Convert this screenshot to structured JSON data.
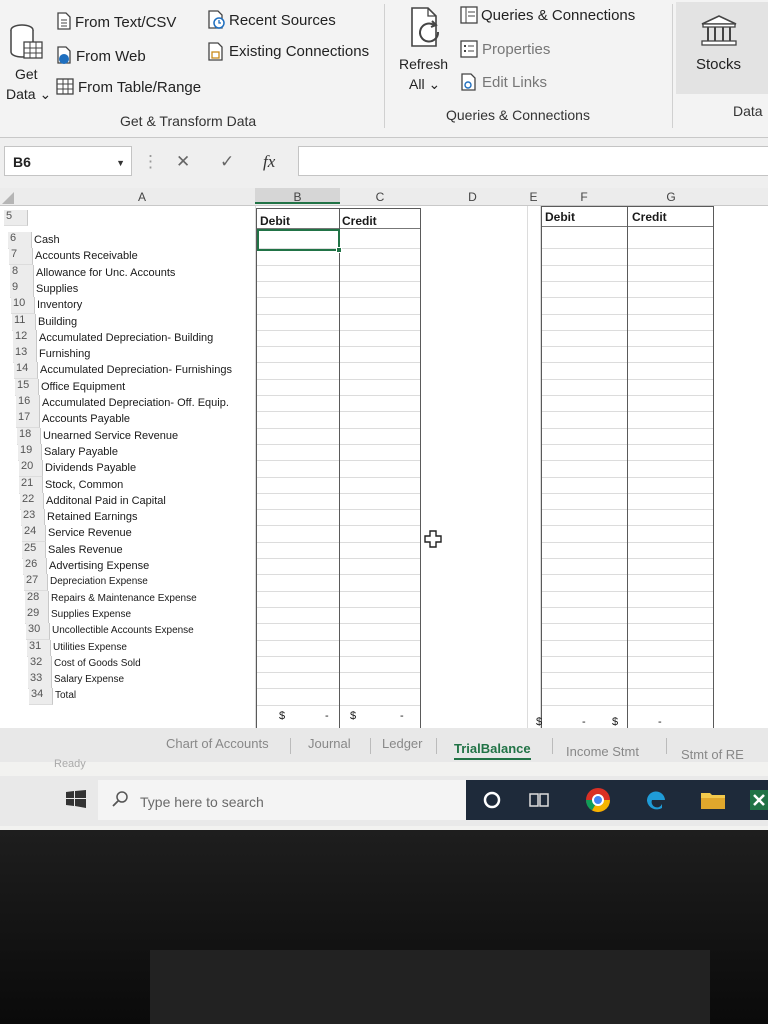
{
  "ribbon": {
    "get_data": {
      "line1": "Get",
      "line2": "Data ⌄"
    },
    "from_text_csv": "From Text/CSV",
    "from_web": "From Web",
    "from_table_range": "From Table/Range",
    "recent_sources": "Recent Sources",
    "existing_connections": "Existing Connections",
    "group_get_transform": "Get & Transform Data",
    "refresh_all": {
      "line1": "Refresh",
      "line2": "All ⌄"
    },
    "queries_connections": "Queries & Connections",
    "properties": "Properties",
    "edit_links": "Edit Links",
    "group_queries": "Queries & Connections",
    "stocks": "Stocks",
    "group_data": "Data"
  },
  "formula_bar": {
    "name_box": "B6",
    "fx": "fx",
    "cancel": "✕",
    "enter": "✓",
    "dots": "⋮"
  },
  "grid": {
    "columns": [
      "A",
      "B",
      "C",
      "D",
      "E",
      "F",
      "G"
    ],
    "header_row": "5",
    "left_headers": {
      "debit": "Debit",
      "credit": "Credit"
    },
    "right_headers": {
      "debit": "Debit",
      "credit": "Credit"
    },
    "rows": [
      {
        "num": "6",
        "label": "Cash"
      },
      {
        "num": "7",
        "label": "Accounts Receivable"
      },
      {
        "num": "8",
        "label": "Allowance for Unc. Accounts"
      },
      {
        "num": "9",
        "label": "Supplies"
      },
      {
        "num": "10",
        "label": "Inventory"
      },
      {
        "num": "11",
        "label": "Building"
      },
      {
        "num": "12",
        "label": "Accumulated Depreciation- Building"
      },
      {
        "num": "13",
        "label": "Furnishing"
      },
      {
        "num": "14",
        "label": "Accumulated Depreciation- Furnishings"
      },
      {
        "num": "15",
        "label": "Office Equipment"
      },
      {
        "num": "16",
        "label": "Accumulated Depreciation- Off. Equip."
      },
      {
        "num": "17",
        "label": "Accounts Payable"
      },
      {
        "num": "18",
        "label": "Unearned Service Revenue"
      },
      {
        "num": "19",
        "label": "Salary Payable"
      },
      {
        "num": "20",
        "label": "Dividends Payable"
      },
      {
        "num": "21",
        "label": "Stock, Common"
      },
      {
        "num": "22",
        "label": "Additonal Paid in Capital"
      },
      {
        "num": "23",
        "label": "Retained Earnings"
      },
      {
        "num": "24",
        "label": "Service Revenue"
      },
      {
        "num": "25",
        "label": "Sales Revenue"
      },
      {
        "num": "26",
        "label": "Advertising Expense"
      },
      {
        "num": "27",
        "label": "Depreciation Expense"
      },
      {
        "num": "28",
        "label": "Repairs & Maintenance Expense"
      },
      {
        "num": "29",
        "label": "Supplies Expense"
      },
      {
        "num": "30",
        "label": "Uncollectible Accounts Expense"
      },
      {
        "num": "31",
        "label": "Utilities Expense"
      },
      {
        "num": "32",
        "label": "Cost of Goods Sold"
      },
      {
        "num": "33",
        "label": "Salary Expense"
      },
      {
        "num": "34",
        "label": "Total"
      }
    ],
    "totals": {
      "currency": "$",
      "dash": "-"
    }
  },
  "sheet_tabs": [
    "Chart of Accounts",
    "Journal",
    "Ledger",
    "TrialBalance",
    "Income Stmt",
    "Stmt of RE"
  ],
  "active_tab": "TrialBalance",
  "status": "Ready",
  "taskbar": {
    "search_placeholder": "Type here to search"
  }
}
